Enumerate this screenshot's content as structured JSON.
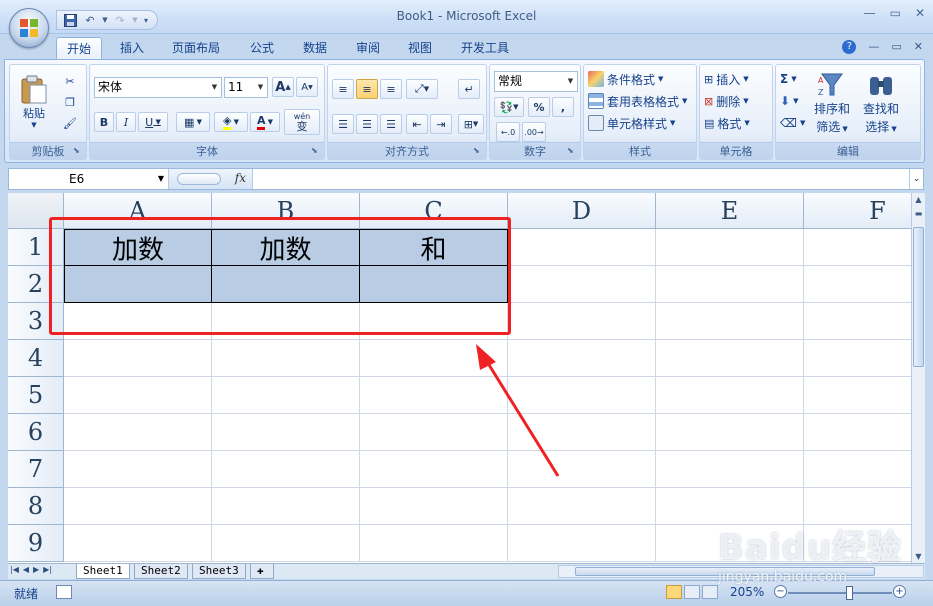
{
  "window": {
    "title": "Book1 - Microsoft Excel"
  },
  "ribbon_tabs": [
    "开始",
    "插入",
    "页面布局",
    "公式",
    "数据",
    "审阅",
    "视图",
    "开发工具"
  ],
  "ribbon": {
    "clipboard": {
      "label": "剪贴板",
      "paste": "粘贴"
    },
    "font": {
      "label": "字体",
      "name": "宋体",
      "size": "11",
      "bold": "B",
      "italic": "I",
      "underline": "U",
      "grow": "A",
      "shrink": "A",
      "color_letter": "A",
      "phonetic_top": "wén",
      "phonetic": "变"
    },
    "alignment": {
      "label": "对齐方式"
    },
    "number": {
      "label": "数字",
      "format": "常规",
      "percent": "%",
      "comma": ","
    },
    "styles": {
      "label": "样式",
      "conditional": "条件格式",
      "table": "套用表格格式",
      "cell": "单元格样式"
    },
    "cells": {
      "label": "单元格",
      "insert": "插入",
      "delete": "删除",
      "format": "格式"
    },
    "editing": {
      "label": "编辑",
      "sigma": "Σ",
      "sort1": "排序和",
      "sort2": "筛选",
      "find1": "查找和",
      "find2": "选择"
    }
  },
  "formula_bar": {
    "name_box": "E6",
    "fx": "fx",
    "formula": ""
  },
  "sheet": {
    "columns": [
      "A",
      "B",
      "C",
      "D",
      "E",
      "F"
    ],
    "rows": [
      "1",
      "2",
      "3",
      "4",
      "5",
      "6",
      "7",
      "8",
      "9"
    ],
    "cells": {
      "A1": "加数",
      "B1": "加数",
      "C1": "和",
      "A2": "",
      "B2": "",
      "C2": ""
    }
  },
  "sheet_tabs": [
    "Sheet1",
    "Sheet2",
    "Sheet3"
  ],
  "status": {
    "ready": "就绪",
    "zoom": "205%"
  },
  "watermark": {
    "line1": "Baidu经验",
    "line2": "jingyan.baidu.com"
  },
  "colors": {
    "annotation": "#ee2222",
    "table_fill": "#b8cce4"
  }
}
